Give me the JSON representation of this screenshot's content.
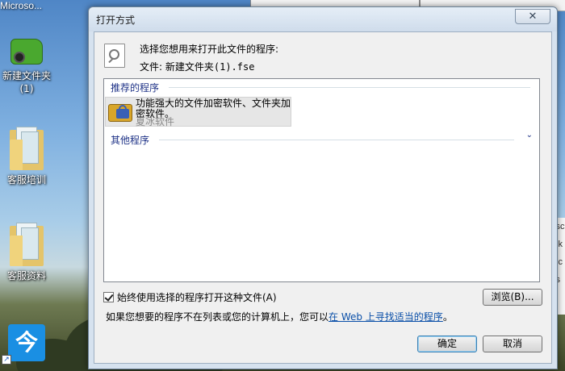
{
  "desktop": {
    "top_label": "Microso...",
    "icons": [
      {
        "label_line1": "新建文件夹",
        "label_line2": "(1)"
      },
      {
        "label": "客服培训"
      },
      {
        "label": "客服资料"
      }
    ],
    "app_glyph": "今",
    "shortcut_glyph": "↗"
  },
  "background": {
    "strip_items": [
      "lsc",
      "sk",
      "sc",
      "is"
    ]
  },
  "dialog": {
    "title": "打开方式",
    "close_glyph": "✕",
    "prompt": "选择您想用来打开此文件的程序:",
    "file_label": "文件:",
    "file_name": "新建文件夹(1).fse",
    "recommended_header": "推荐的程序",
    "program": {
      "description": "功能强大的文件加密软件、文件夹加密软件。",
      "vendor": "夏冰软件"
    },
    "other_header": "其他程序",
    "collapse_glyph": "⌄",
    "always_use_label": "始终使用选择的程序打开这种文件(A)",
    "always_use_checked": true,
    "browse_label": "浏览(B)...",
    "info_text": "如果您想要的程序不在列表或您的计算机上，您可以",
    "info_link": "在 Web 上寻找适当的程序",
    "info_suffix": "。",
    "ok_label": "确定",
    "cancel_label": "取消"
  }
}
